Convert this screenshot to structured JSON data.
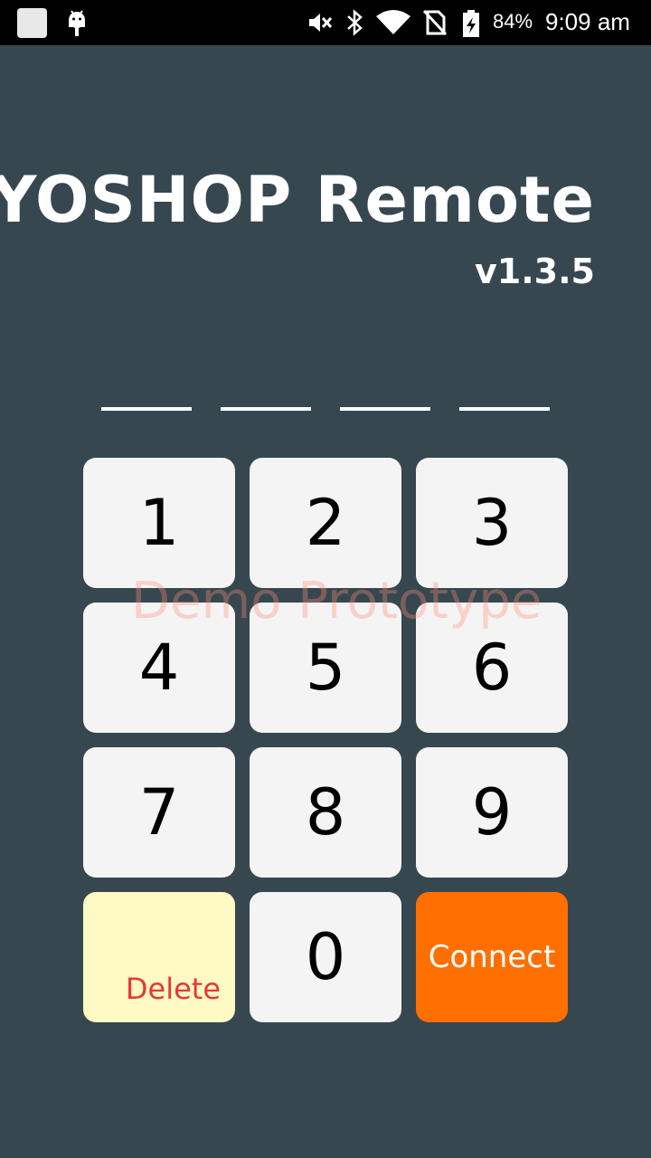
{
  "status_bar": {
    "battery_percent": "84%",
    "time": "9:09 am",
    "icons": [
      "app-icon",
      "android-icon",
      "mute-icon",
      "bluetooth-icon",
      "wifi-icon",
      "no-sim-icon",
      "battery-charging-icon"
    ]
  },
  "header": {
    "title": "YOSHOP Remote",
    "version": "v1.3.5"
  },
  "pin": {
    "slot_count": 4
  },
  "keypad": {
    "keys": [
      "1",
      "2",
      "3",
      "4",
      "5",
      "6",
      "7",
      "8",
      "9"
    ],
    "delete_label": "Delete",
    "zero_label": "0",
    "connect_label": "Connect"
  },
  "watermark": "Demo Prototype",
  "colors": {
    "background": "#37474f",
    "key": "#f4f4f4",
    "delete_key": "#fff9c4",
    "delete_text": "#e53935",
    "connect_key": "#ff6f00"
  }
}
